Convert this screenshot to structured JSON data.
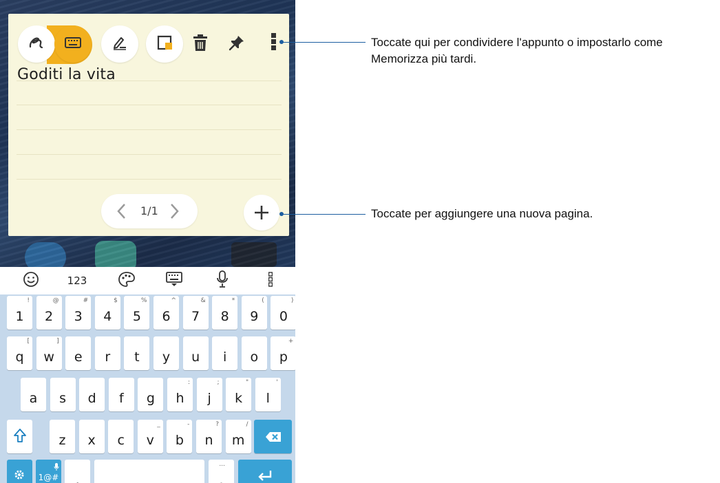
{
  "note": {
    "title": "Goditi la vita",
    "page_indicator": "1/1"
  },
  "toolbar_icons": [
    "handwriting-icon",
    "keyboard-icon",
    "pen-icon",
    "sticky-note-icon",
    "trash-icon",
    "pin-icon",
    "more-vertical-icon"
  ],
  "keyboard": {
    "toolbar": {
      "numbers_label": "123"
    },
    "row_numbers": [
      {
        "main": "1",
        "sub": "!"
      },
      {
        "main": "2",
        "sub": "@"
      },
      {
        "main": "3",
        "sub": "#"
      },
      {
        "main": "4",
        "sub": "$"
      },
      {
        "main": "5",
        "sub": "%"
      },
      {
        "main": "6",
        "sub": "^"
      },
      {
        "main": "7",
        "sub": "&"
      },
      {
        "main": "8",
        "sub": "*"
      },
      {
        "main": "9",
        "sub": "("
      },
      {
        "main": "0",
        "sub": ")"
      }
    ],
    "row_top": [
      {
        "main": "q",
        "sub": "["
      },
      {
        "main": "w",
        "sub": "]"
      },
      {
        "main": "e",
        "sub": ""
      },
      {
        "main": "r",
        "sub": ""
      },
      {
        "main": "t",
        "sub": ""
      },
      {
        "main": "y",
        "sub": ""
      },
      {
        "main": "u",
        "sub": ""
      },
      {
        "main": "i",
        "sub": ""
      },
      {
        "main": "o",
        "sub": ""
      },
      {
        "main": "p",
        "sub": "+"
      }
    ],
    "row_home": [
      {
        "main": "a",
        "sub": ""
      },
      {
        "main": "s",
        "sub": ""
      },
      {
        "main": "d",
        "sub": ""
      },
      {
        "main": "f",
        "sub": ""
      },
      {
        "main": "g",
        "sub": ""
      },
      {
        "main": "h",
        "sub": ":"
      },
      {
        "main": "j",
        "sub": ";"
      },
      {
        "main": "k",
        "sub": "\""
      },
      {
        "main": "l",
        "sub": "'"
      }
    ],
    "row_bottom": [
      {
        "main": "z",
        "sub": ""
      },
      {
        "main": "x",
        "sub": ""
      },
      {
        "main": "c",
        "sub": ""
      },
      {
        "main": "v",
        "sub": "_"
      },
      {
        "main": "b",
        "sub": "-"
      },
      {
        "main": "n",
        "sub": "?"
      },
      {
        "main": "m",
        "sub": "/"
      }
    ],
    "symbols_label": "1@#",
    "comma": ",",
    "period": ".",
    "period_sub": "..."
  },
  "callouts": {
    "more_menu": "Toccate qui per condividere l'appunto o impostarlo come Memorizza più tardi.",
    "add_page": "Toccate per aggiungere una nuova pagina."
  },
  "colors": {
    "accent_yellow": "#f2b01e",
    "note_bg": "#f8f6dd",
    "keyboard_bg": "#c5d8eb",
    "key_blue": "#39a2d5",
    "callout_line": "#1c5ea0"
  }
}
